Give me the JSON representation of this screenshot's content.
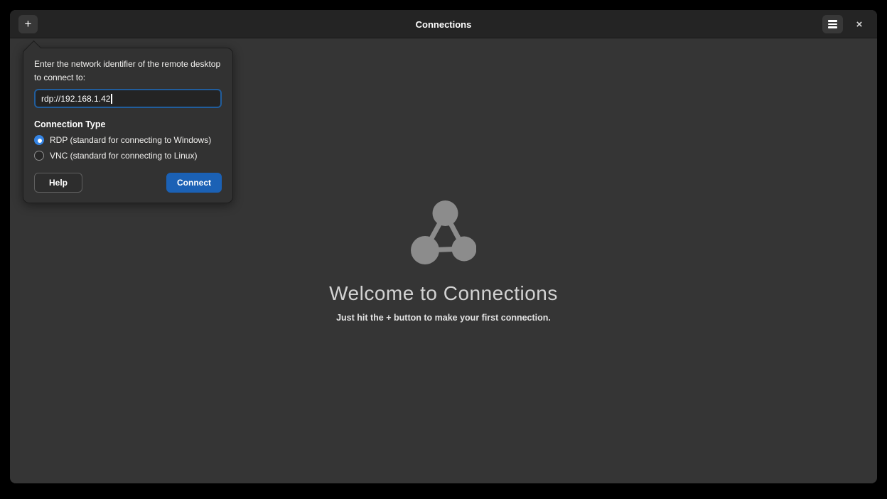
{
  "header": {
    "title": "Connections",
    "new_connection_glyph": "+",
    "close_glyph": "×"
  },
  "popover": {
    "prompt": "Enter the network identifier of the remote desktop to connect to:",
    "address_value": "rdp://192.168.1.42",
    "connection_type_label": "Connection Type",
    "options": [
      {
        "label": "RDP (standard for connecting to Windows)",
        "selected": true
      },
      {
        "label": "VNC (standard for connecting to Linux)",
        "selected": false
      }
    ],
    "help_label": "Help",
    "connect_label": "Connect"
  },
  "welcome": {
    "title": "Welcome to Connections",
    "description_prefix": "Just hit the ",
    "description_plus": "+",
    "description_suffix": " button to make your first connection."
  },
  "colors": {
    "accent_blue": "#3584e4",
    "suggested_action_blue": "#1b61b5",
    "entry_focus_ring": "#215d9c",
    "headerbar_bg": "#242424",
    "window_bg": "#353535",
    "popover_bg": "#323232",
    "icon_gray": "#8c8c8c"
  }
}
